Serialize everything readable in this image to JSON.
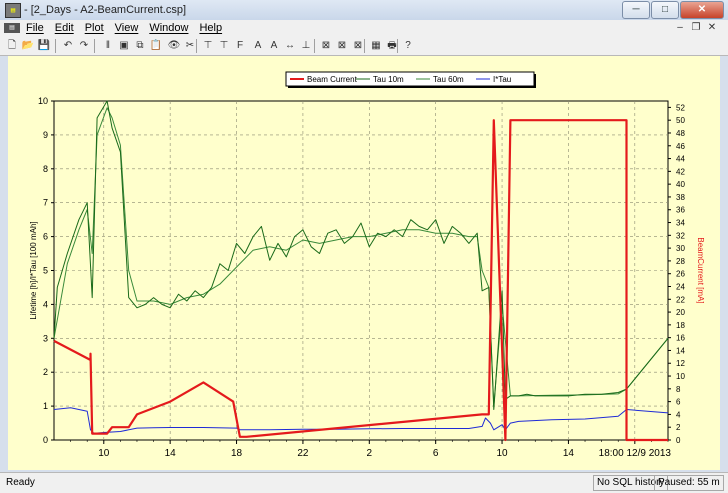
{
  "window": {
    "title": "- [2_Days - A2-BeamCurrent.csp]",
    "minimize": "─",
    "maximize": "□",
    "close": "✕"
  },
  "menu": {
    "items": [
      "File",
      "Edit",
      "Plot",
      "View",
      "Window",
      "Help"
    ],
    "mdi_min": "–",
    "mdi_restore": "❐",
    "mdi_close": "✕"
  },
  "toolbar": {
    "icons": [
      "new-icon",
      "open-icon",
      "save-icon",
      "undo-icon",
      "redo-icon",
      "pause-icon",
      "image-icon",
      "copy-icon",
      "paste-icon",
      "eye-icon",
      "fit-icon",
      "fit-x-icon",
      "fit-y-icon",
      "font-icon",
      "font-larger-icon",
      "font-smaller-icon",
      "range-icon",
      "marker-icon",
      "x-box-icon",
      "y-box-icon",
      "y2-box-icon",
      "grid-icon",
      "print-icon",
      "help-icon"
    ],
    "glyphs": [
      "🗋",
      "📂",
      "💾",
      "↶",
      "↷",
      "‖",
      "▣",
      "⧉",
      "📋",
      "👁",
      "✂",
      "⊤",
      "⊤",
      "F",
      "A",
      "A",
      "↔",
      "⊥",
      "⊠",
      "⊠",
      "⊠",
      "▦",
      "🖶",
      "?"
    ]
  },
  "status": {
    "ready": "Ready",
    "sql": "No SQL history",
    "paused": "Paused: 55 m"
  },
  "chart_data": {
    "type": "line",
    "legend": [
      "Beam Current",
      "Tau 10m",
      "Tau 60m",
      "I*Tau"
    ],
    "legend_placement": "top-center",
    "ylabel_left": "Lifetime [h]/I*Tau [100 mAh]",
    "ylabel_right": "BeamCurrent [mA]",
    "ylim_left": [
      0,
      10
    ],
    "ylim_right": [
      0,
      53
    ],
    "yticks_left": [
      "0",
      "1",
      "2",
      "3",
      "4",
      "5",
      "6",
      "7",
      "8",
      "9",
      "10"
    ],
    "yticks_right": [
      "0",
      "2",
      "4",
      "6",
      "8",
      "10",
      "12",
      "14",
      "16",
      "18",
      "20",
      "22",
      "24",
      "26",
      "28",
      "30",
      "32",
      "34",
      "36",
      "38",
      "40",
      "42",
      "44",
      "46",
      "48",
      "50",
      "52"
    ],
    "xticks": [
      "10",
      "14",
      "18",
      "22",
      "2",
      "6",
      "10",
      "14",
      "18:00 12/9 2013"
    ],
    "x_unit": "hours",
    "x_range": [
      7,
      40
    ],
    "colors": {
      "beam": "#e41a1c",
      "tau10": "#1a6a1a",
      "tau60": "#3a8a3a",
      "itau": "#1f2bd6"
    },
    "series": [
      {
        "name": "Beam Current",
        "axis": "right",
        "x": [
          7,
          9.2,
          9.2,
          9.3,
          9.3,
          10.2,
          10.2,
          10.5,
          10.5,
          11.5,
          11.5,
          12,
          12,
          14,
          14,
          16,
          16,
          17.8,
          17.8,
          18.2,
          18.2,
          18.6,
          18.6,
          32.8,
          32.8,
          33.2,
          33.2,
          33.5,
          33.5,
          34.2,
          34.2,
          34.5,
          34.5,
          35,
          35,
          41.5,
          41.5,
          44
        ],
        "values": [
          15.5,
          12.5,
          13.5,
          1,
          1,
          1,
          1,
          2,
          2,
          2,
          2,
          4,
          4,
          6,
          6,
          9,
          9,
          6,
          6,
          0.5,
          0.5,
          0.5,
          0.5,
          4,
          4,
          4,
          4,
          50,
          50,
          0,
          0,
          50,
          50,
          50,
          50,
          50,
          0,
          0
        ]
      },
      {
        "name": "Tau 10m",
        "axis": "left",
        "x": [
          7,
          7.2,
          7.8,
          8.5,
          9,
          9.3,
          9.6,
          10.2,
          10.5,
          11,
          11.5,
          12,
          12.5,
          13,
          13.5,
          14,
          14.5,
          15,
          15.5,
          16,
          16.5,
          17,
          17.5,
          18,
          18.5,
          19,
          19.5,
          20,
          20.5,
          21,
          21.5,
          22,
          22.5,
          23,
          23.5,
          24,
          24.5,
          25,
          25.5,
          26,
          26.5,
          27,
          27.5,
          28,
          28.5,
          29,
          29.5,
          30,
          30.5,
          31,
          31.5,
          32,
          32.5,
          32.8,
          33.2,
          33.5,
          34,
          34.2,
          34.5,
          34.8,
          35,
          35.5,
          36,
          37,
          38,
          39,
          40,
          41,
          41.5,
          44
        ],
        "values": [
          3,
          4.5,
          5.5,
          6.5,
          7,
          4.2,
          9.5,
          10,
          9.2,
          8.5,
          4.2,
          3.9,
          4,
          4.2,
          4,
          3.9,
          4.3,
          4.1,
          4.4,
          4.2,
          4.5,
          5.2,
          5,
          5.8,
          5.5,
          6,
          6.3,
          5.3,
          5.8,
          5.4,
          6,
          6.2,
          5.7,
          5.5,
          6.1,
          6.2,
          5.8,
          6,
          6.4,
          5.7,
          6.1,
          6,
          6.2,
          6,
          6.5,
          6.3,
          6.2,
          6.5,
          5.8,
          6.3,
          6.1,
          5.8,
          6.1,
          4.4,
          4.5,
          0.9,
          4.4,
          1.2,
          1.3,
          1.3,
          1.3,
          1.35,
          1.3,
          1.3,
          1.3,
          1.35,
          1.35,
          1.4,
          1.5,
          3
        ]
      },
      {
        "name": "Tau 60m",
        "axis": "left",
        "x": [
          7,
          7.8,
          8.5,
          9,
          9.3,
          9.6,
          10.2,
          10.5,
          11,
          11.5,
          12,
          13,
          14,
          15,
          16,
          17,
          18,
          19,
          20,
          21,
          22,
          23,
          24,
          25,
          26,
          27,
          28,
          29,
          30,
          31,
          32,
          32.5,
          32.8,
          33.2,
          33.5,
          34,
          34.5,
          35,
          37,
          39,
          41,
          41.5,
          44
        ],
        "values": [
          3,
          5.2,
          6.2,
          6.8,
          5.5,
          9,
          9.8,
          9.5,
          8.7,
          5,
          4.1,
          4.1,
          4,
          4.2,
          4.3,
          4.6,
          5.1,
          5.6,
          5.7,
          5.6,
          5.9,
          5.8,
          5.9,
          6,
          6,
          6.1,
          6.2,
          6.2,
          6.1,
          6.1,
          6,
          6,
          5,
          4.5,
          1,
          4,
          1.3,
          1.3,
          1.32,
          1.33,
          1.36,
          1.5,
          3
        ]
      },
      {
        "name": "I*Tau",
        "axis": "left",
        "x": [
          7,
          8,
          9,
          9.2,
          9.4,
          10,
          11,
          12,
          13,
          14,
          16,
          18,
          18.2,
          20,
          22,
          24,
          26,
          28,
          30,
          32,
          32.8,
          33,
          33.3,
          33.5,
          34,
          34.2,
          34.5,
          35,
          37,
          39,
          41,
          41.5,
          44
        ],
        "values": [
          0.9,
          0.95,
          0.85,
          0.3,
          0.2,
          0.22,
          0.25,
          0.35,
          0.36,
          0.37,
          0.37,
          0.35,
          0.3,
          0.3,
          0.32,
          0.32,
          0.33,
          0.34,
          0.34,
          0.34,
          0.4,
          0.65,
          0.5,
          0.3,
          0.45,
          0.3,
          0.5,
          0.55,
          0.6,
          0.62,
          0.7,
          0.9,
          0.8
        ]
      }
    ]
  }
}
